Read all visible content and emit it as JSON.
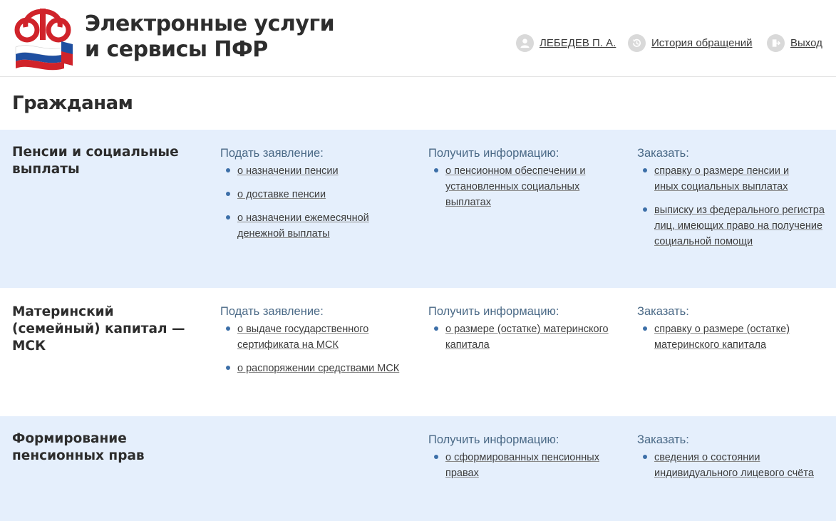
{
  "header": {
    "title_line1": "Электронные услуги",
    "title_line2": "и сервисы ПФР",
    "user_name": "ЛЕБЕДЕВ П. А.",
    "history_label": "История обращений",
    "logout_label": "Выход"
  },
  "page": {
    "heading": "Гражданам"
  },
  "colors": {
    "accent_blue": "#3c6fa8",
    "section_blue": "#e5effc",
    "heading_blue": "#4a6986"
  },
  "sections": [
    {
      "title": "Пенсии и социальные выплаты",
      "apply": {
        "heading": "Подать заявление:",
        "items": [
          "о назначении пенсии",
          "о доставке пенсии",
          "о назначении ежемесячной денежной выплаты"
        ]
      },
      "info": {
        "heading": "Получить информацию:",
        "items": [
          "о пенсионном обеспечении и установленных социальных выплатах"
        ]
      },
      "order": {
        "heading": "Заказать:",
        "items": [
          "справку о размере пенсии и иных социальных выплатах",
          "выписку из федерального регистра лиц, имеющих право на получение социальной помощи"
        ]
      }
    },
    {
      "title": "Материнский (семейный) капитал — МСК",
      "apply": {
        "heading": "Подать заявление:",
        "items": [
          "о выдаче государственного сертификата на МСК",
          "о распоряжении средствами МСК"
        ]
      },
      "info": {
        "heading": "Получить информацию:",
        "items": [
          "о размере (остатке) материнского капитала"
        ]
      },
      "order": {
        "heading": "Заказать:",
        "items": [
          "справку о размере (остатке) материнского капитала"
        ]
      }
    },
    {
      "title": "Формирование пенсионных прав",
      "info": {
        "heading": "Получить информацию:",
        "items": [
          "о сформированных пенсионных правах"
        ]
      },
      "order": {
        "heading": "Заказать:",
        "items": [
          "сведения о состоянии индивидуального лицевого счёта"
        ]
      }
    }
  ],
  "icons": {
    "user": "user-avatar-icon",
    "history": "history-clock-icon",
    "logout": "logout-door-icon"
  }
}
